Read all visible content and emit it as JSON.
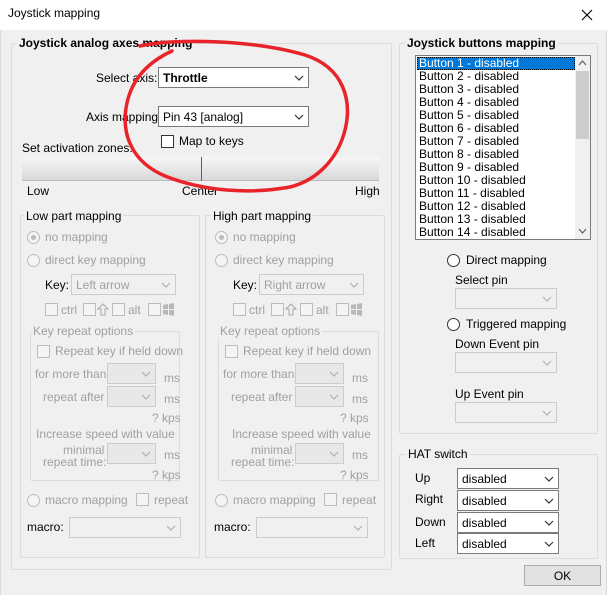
{
  "window": {
    "title": "Joystick mapping"
  },
  "analog": {
    "group_title": "Joystick analog axes mapping",
    "select_axis_label": "Select axis:",
    "select_axis_value": "Throttle",
    "axis_mapping_label": "Axis mapping:",
    "axis_mapping_value": "Pin 43 [analog]",
    "map_to_keys_label": "Map to keys",
    "activation_label": "Set activation zones:",
    "low_label": "Low",
    "center_label": "Center",
    "high_label": "High"
  },
  "low_part": {
    "title": "Low part mapping",
    "no_mapping": "no mapping",
    "direct_key": "direct key mapping",
    "key_label": "Key:",
    "key_value": "Left arrow",
    "ctrl": "ctrl",
    "alt": "alt",
    "repeat_title": "Key repeat options",
    "repeat_if_held": "Repeat key if held down",
    "for_more_than": "for more than",
    "repeat_after": "repeat after",
    "ms1": "ms",
    "ms2": "ms",
    "kps1": "? kps",
    "increase_speed": "Increase speed with value",
    "minimal": "minimal",
    "repeat_time": "repeat time:",
    "ms3": "ms",
    "kps2": "? kps",
    "macro_mapping": "macro mapping",
    "repeat": "repeat",
    "macro_label": "macro:"
  },
  "high_part": {
    "title": "High part mapping",
    "no_mapping": "no mapping",
    "direct_key": "direct key mapping",
    "key_label": "Key:",
    "key_value": "Right arrow",
    "ctrl": "ctrl",
    "alt": "alt",
    "repeat_title": "Key repeat options",
    "repeat_if_held": "Repeat key if held down",
    "for_more_than": "for more than",
    "repeat_after": "repeat after",
    "ms1": "ms",
    "ms2": "ms",
    "kps1": "? kps",
    "increase_speed": "Increase speed with value",
    "minimal": "minimal",
    "repeat_time": "repeat time:",
    "ms3": "ms",
    "kps2": "? kps",
    "macro_mapping": "macro mapping",
    "repeat": "repeat",
    "macro_label": "macro:"
  },
  "buttons": {
    "title": "Joystick buttons mapping",
    "items": [
      "Button 1 - disabled",
      "Button 2 - disabled",
      "Button 3 - disabled",
      "Button 4 - disabled",
      "Button 5 - disabled",
      "Button 6 - disabled",
      "Button 7 - disabled",
      "Button 8 - disabled",
      "Button 9 - disabled",
      "Button 10 - disabled",
      "Button 11 - disabled",
      "Button 12 - disabled",
      "Button 13 - disabled",
      "Button 14 - disabled"
    ],
    "direct_mapping": "Direct mapping",
    "select_pin": "Select pin",
    "triggered_mapping": "Triggered mapping",
    "down_event_pin": "Down Event pin",
    "up_event_pin": "Up Event pin"
  },
  "hat": {
    "title": "HAT switch",
    "up_label": "Up",
    "up_value": "disabled",
    "right_label": "Right",
    "right_value": "disabled",
    "down_label": "Down",
    "down_value": "disabled",
    "left_label": "Left",
    "left_value": "disabled"
  },
  "ok_label": "OK",
  "colors": {
    "selection": "#0078d7",
    "annotation": "#e8232a"
  }
}
